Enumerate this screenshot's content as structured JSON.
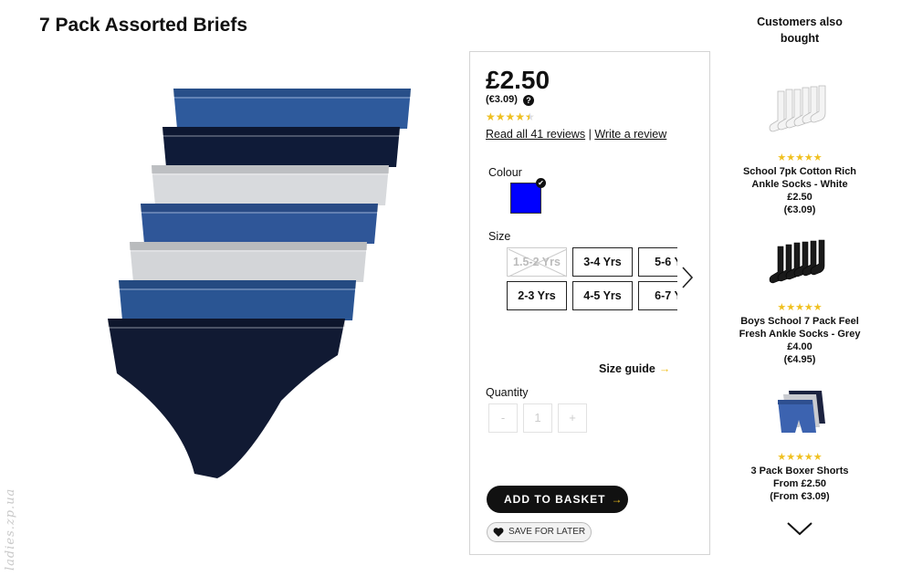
{
  "product": {
    "title": "7 Pack Assorted Briefs",
    "price": "£2.50",
    "price_eur": "(€3.09)",
    "rating_stars": "★★★★★",
    "rating": 4.5,
    "reviews_link": "Read all 41 reviews",
    "separator": "|",
    "write_review_link": "Write a review",
    "colour_label": "Colour",
    "selected_colour": "#0000ff",
    "size_label": "Size",
    "sizes": [
      {
        "label": "1.5-2 Yrs",
        "available": false
      },
      {
        "label": "3-4 Yrs",
        "available": true
      },
      {
        "label": "5-6 Y",
        "available": true
      },
      {
        "label": "2-3 Yrs",
        "available": true
      },
      {
        "label": "4-5 Yrs",
        "available": true
      },
      {
        "label": "6-7 Y",
        "available": true
      }
    ],
    "size_guide": "Size guide",
    "quantity_label": "Quantity",
    "qty_minus": "-",
    "qty_value": "1",
    "qty_plus": "+",
    "add_to_basket": "ADD TO BASKET",
    "save_for_later": "SAVE FOR LATER",
    "accent_color": "#f0c020",
    "brief_colors": [
      "#2e5a9c",
      "#0f1b38",
      "#d8dadd",
      "#2f5698",
      "#d3d5d8",
      "#2a5593",
      "#111a33"
    ]
  },
  "watermark": "ladies.zp.ua",
  "recommendations": {
    "title": "Customers also bought",
    "items": [
      {
        "stars": "★★★★★",
        "name": "School 7pk Cotton Rich Ankle Socks - White",
        "price": "£2.50",
        "price_eur": "(€3.09)",
        "icon": "white-socks"
      },
      {
        "stars": "★★★★★",
        "name": "Boys School 7 Pack Feel Fresh Ankle Socks - Grey",
        "price": "£4.00",
        "price_eur": "(€4.95)",
        "icon": "black-socks"
      },
      {
        "stars": "★★★★★",
        "name": "3 Pack Boxer Shorts",
        "price": "From £2.50",
        "price_eur": "(From €3.09)",
        "icon": "boxer-shorts"
      }
    ]
  }
}
